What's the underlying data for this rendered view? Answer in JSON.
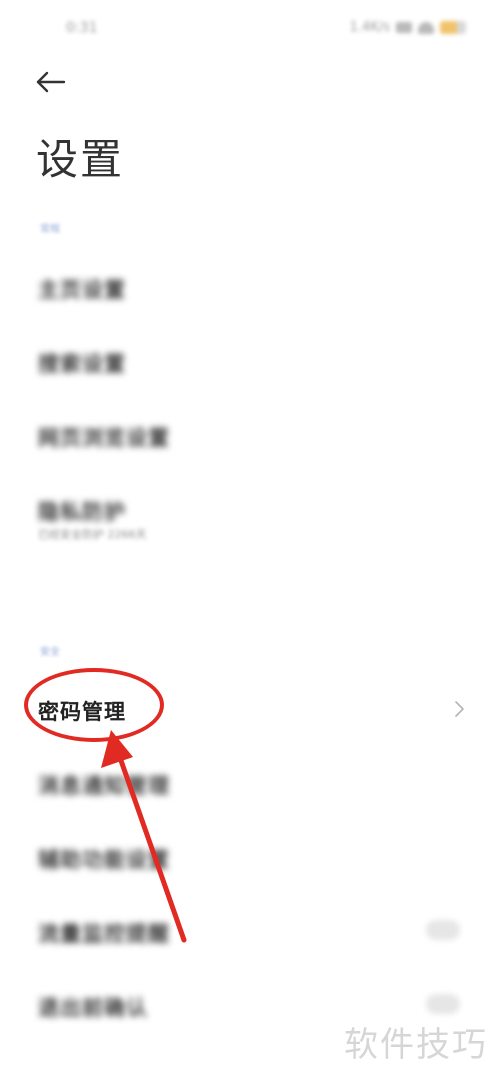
{
  "status_bar": {
    "time": "0:31",
    "net_speed": "1.4K/s"
  },
  "header": {
    "back_icon": "arrow-left-icon",
    "title": "设置"
  },
  "sections": {
    "general_label": "常规",
    "security_label": "安全"
  },
  "items": {
    "homepage": "主页设置",
    "search": "搜索设置",
    "browsing": "网页浏览设置",
    "privacy": "隐私防护",
    "privacy_sub": "已经安全防护 2266天",
    "password": "密码管理",
    "notifications": "消息通知管理",
    "accessibility": "辅助功能设置",
    "traffic": "流量监控提醒",
    "exit_confirm": "退出前确认"
  },
  "icons": {
    "chevron": "chevron-right-icon"
  },
  "annotation": {
    "color": "#e12a22"
  },
  "watermark": {
    "text": "软件技巧"
  }
}
